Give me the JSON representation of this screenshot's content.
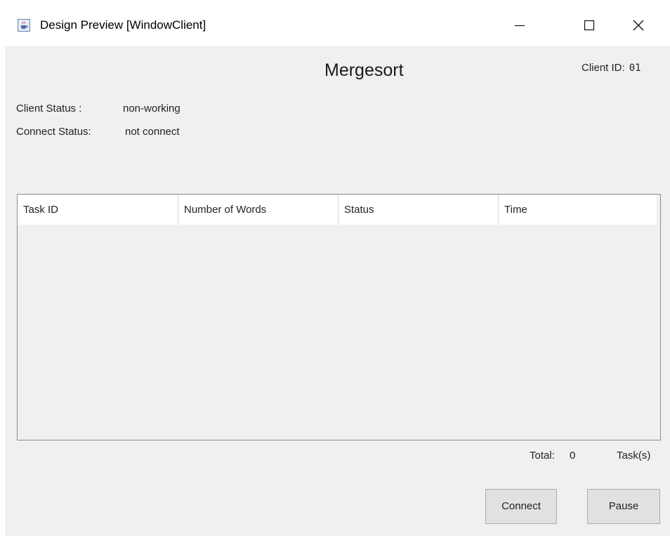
{
  "window": {
    "title": "Design Preview [WindowClient]",
    "app_icon": "java-cup-icon",
    "controls": {
      "minimize": "minimize-icon",
      "maximize": "maximize-icon",
      "close": "close-icon"
    }
  },
  "header": {
    "title": "Mergesort",
    "client_id_label": "Client ID:",
    "client_id_value": "01"
  },
  "status": {
    "client_status_label": "Client Status :",
    "client_status_value": "non-working",
    "connect_status_label": "Connect Status:",
    "connect_status_value": "not connect"
  },
  "table": {
    "columns": [
      "Task ID",
      "Number of Words",
      "Status",
      "Time"
    ],
    "rows": []
  },
  "footer": {
    "total_label": "Total:",
    "total_count": "0",
    "total_unit": "Task(s)"
  },
  "buttons": {
    "connect_label": "Connect",
    "pause_label": "Pause"
  },
  "colors": {
    "panel_background": "#f0f0f0",
    "button_background": "#e1e1e1",
    "button_border": "#adadad",
    "table_border": "#8c8c8c"
  }
}
